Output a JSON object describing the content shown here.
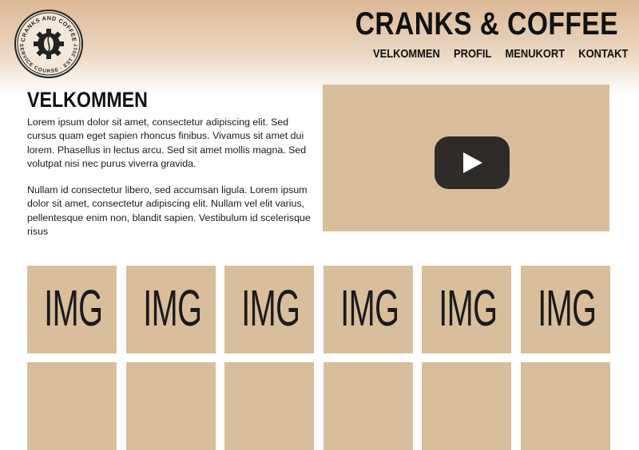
{
  "brand": {
    "title": "CRANKS & COFFEE",
    "logo_top_text": "CRANKS AND COFFEE",
    "logo_bottom_text": "SERVICE COURSE · EST 2017",
    "logo_icon": "gear-coffee-bean-icon"
  },
  "nav": {
    "items": [
      {
        "label": "VELKOMMEN"
      },
      {
        "label": "PROFIL"
      },
      {
        "label": "MENUKORT"
      },
      {
        "label": "KONTAKT"
      }
    ]
  },
  "intro": {
    "heading": "VELKOMMEN",
    "paragraphs": [
      "Lorem ipsum dolor sit amet, consectetur adipiscing elit. Sed cursus quam eget sapien rhoncus finibus. Vivamus sit amet dui lorem. Phasellus in lectus arcu. Sed sit amet mollis magna. Sed volutpat nisi nec purus viverra gravida.",
      "Nullam id consectetur libero, sed accumsan ligula. Lorem ipsum dolor sit amet, consectetur adipiscing elit. Nullam vel elit varius, pellentesque enim non, blandit sapien. Vestibulum id scelerisque risus"
    ]
  },
  "video": {
    "icon": "play-icon"
  },
  "gallery": {
    "tiles": [
      {
        "label": "IMG"
      },
      {
        "label": "IMG"
      },
      {
        "label": "IMG"
      },
      {
        "label": "IMG"
      },
      {
        "label": "IMG"
      },
      {
        "label": "IMG"
      },
      {
        "label": ""
      },
      {
        "label": ""
      },
      {
        "label": ""
      },
      {
        "label": ""
      },
      {
        "label": ""
      },
      {
        "label": ""
      }
    ]
  },
  "colors": {
    "tan": "#d9be9c",
    "header_gradient_top": "#dcb996",
    "play_button": "#2e2b28",
    "text": "#111111"
  }
}
